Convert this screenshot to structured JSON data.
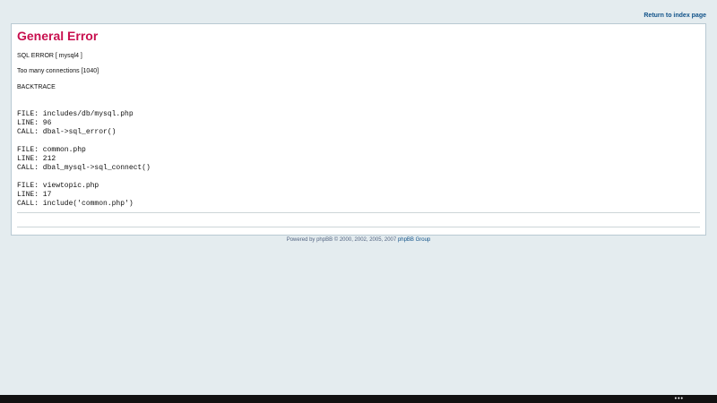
{
  "header": {
    "return_link": "Return to index page"
  },
  "error": {
    "title": "General Error",
    "sql_error": "SQL ERROR [ mysql4 ]",
    "message": "Too many connections [1040]",
    "backtrace_label": "BACKTRACE",
    "backtrace": [
      {
        "file": "FILE: includes/db/mysql.php",
        "line": "LINE: 96",
        "call": "CALL: dbal->sql_error()"
      },
      {
        "file": "FILE: common.php",
        "line": "LINE: 212",
        "call": "CALL: dbal_mysql->sql_connect()"
      },
      {
        "file": "FILE: viewtopic.php",
        "line": "LINE: 17",
        "call": "CALL: include('common.php')"
      }
    ]
  },
  "footer": {
    "powered_text": "Powered by phpBB © 2000, 2002, 2005, 2007",
    "group_link": "phpBB Group"
  },
  "taskbar": {
    "menu_glyph": "•••"
  }
}
